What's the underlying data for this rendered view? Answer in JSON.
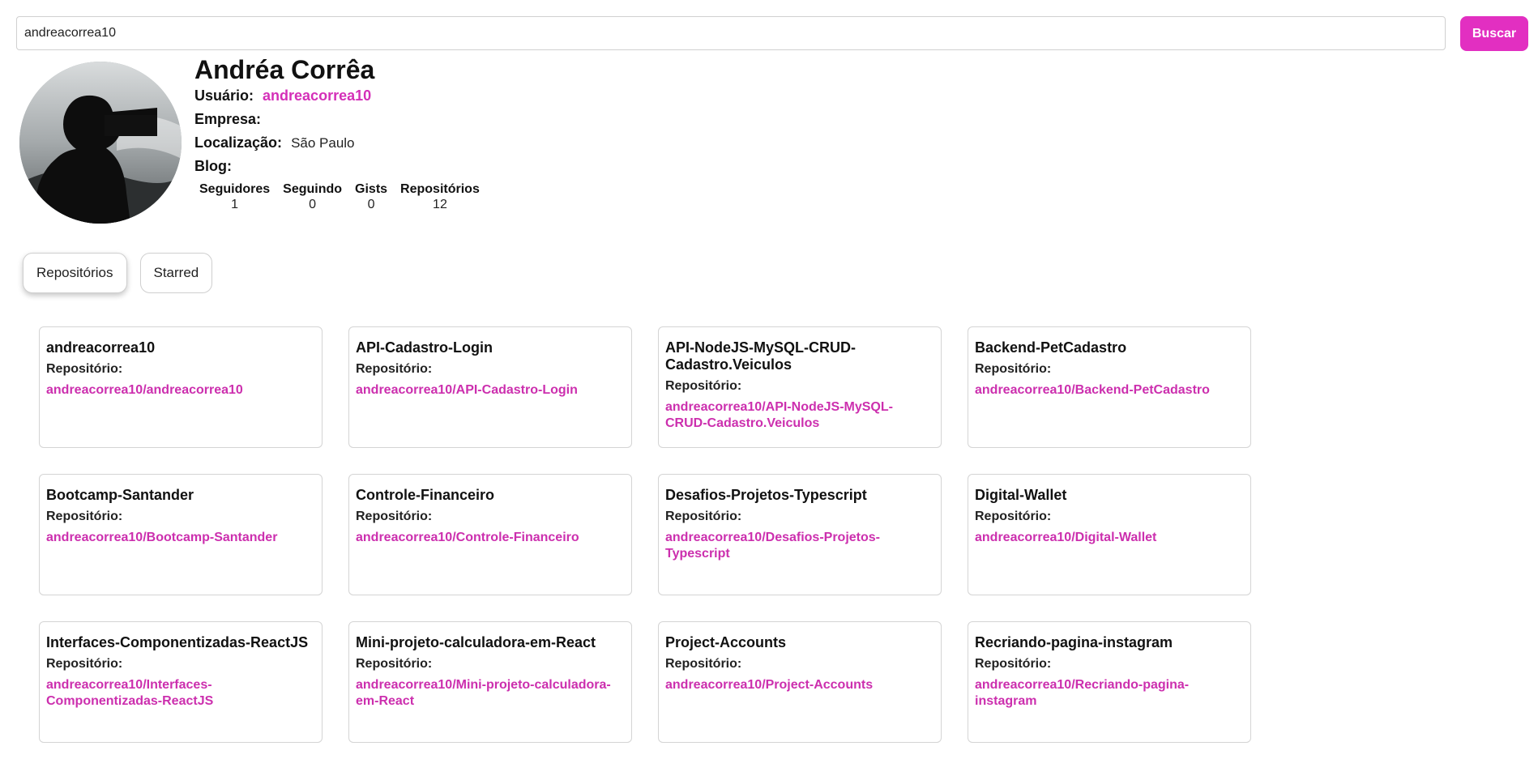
{
  "search": {
    "value": "andreacorrea10",
    "placeholder": "",
    "button_label": "Buscar"
  },
  "profile": {
    "name": "Andréa Corrêa",
    "user_label": "Usuário:",
    "user_value": "andreacorrea10",
    "company_label": "Empresa:",
    "company_value": "",
    "location_label": "Localização:",
    "location_value": "São Paulo",
    "blog_label": "Blog:",
    "blog_value": "",
    "stats": [
      {
        "label": "Seguidores",
        "value": "1"
      },
      {
        "label": "Seguindo",
        "value": "0"
      },
      {
        "label": "Gists",
        "value": "0"
      },
      {
        "label": "Repositórios",
        "value": "12"
      }
    ]
  },
  "tabs": [
    {
      "label": "Repositórios",
      "active": true
    },
    {
      "label": "Starred",
      "active": false
    }
  ],
  "repo_label": "Repositório:",
  "repos": [
    {
      "name": "andreacorrea10",
      "full_name": "andreacorrea10/andreacorrea10"
    },
    {
      "name": "API-Cadastro-Login",
      "full_name": "andreacorrea10/API-Cadastro-Login"
    },
    {
      "name": "API-NodeJS-MySQL-CRUD-Cadastro.Veiculos",
      "full_name": "andreacorrea10/API-NodeJS-MySQL-CRUD-Cadastro.Veiculos"
    },
    {
      "name": "Backend-PetCadastro",
      "full_name": "andreacorrea10/Backend-PetCadastro"
    },
    {
      "name": "Bootcamp-Santander",
      "full_name": "andreacorrea10/Bootcamp-Santander"
    },
    {
      "name": "Controle-Financeiro",
      "full_name": "andreacorrea10/Controle-Financeiro"
    },
    {
      "name": "Desafios-Projetos-Typescript",
      "full_name": "andreacorrea10/Desafios-Projetos-Typescript"
    },
    {
      "name": "Digital-Wallet",
      "full_name": "andreacorrea10/Digital-Wallet"
    },
    {
      "name": "Interfaces-Componentizadas-ReactJS",
      "full_name": "andreacorrea10/Interfaces-Componentizadas-ReactJS"
    },
    {
      "name": "Mini-projeto-calculadora-em-React",
      "full_name": "andreacorrea10/Mini-projeto-calculadora-em-React"
    },
    {
      "name": "Project-Accounts",
      "full_name": "andreacorrea10/Project-Accounts"
    },
    {
      "name": "Recriando-pagina-instagram",
      "full_name": "andreacorrea10/Recriando-pagina-instagram"
    }
  ],
  "colors": {
    "accent": "#e22fc1",
    "link": "#cc2fae"
  }
}
